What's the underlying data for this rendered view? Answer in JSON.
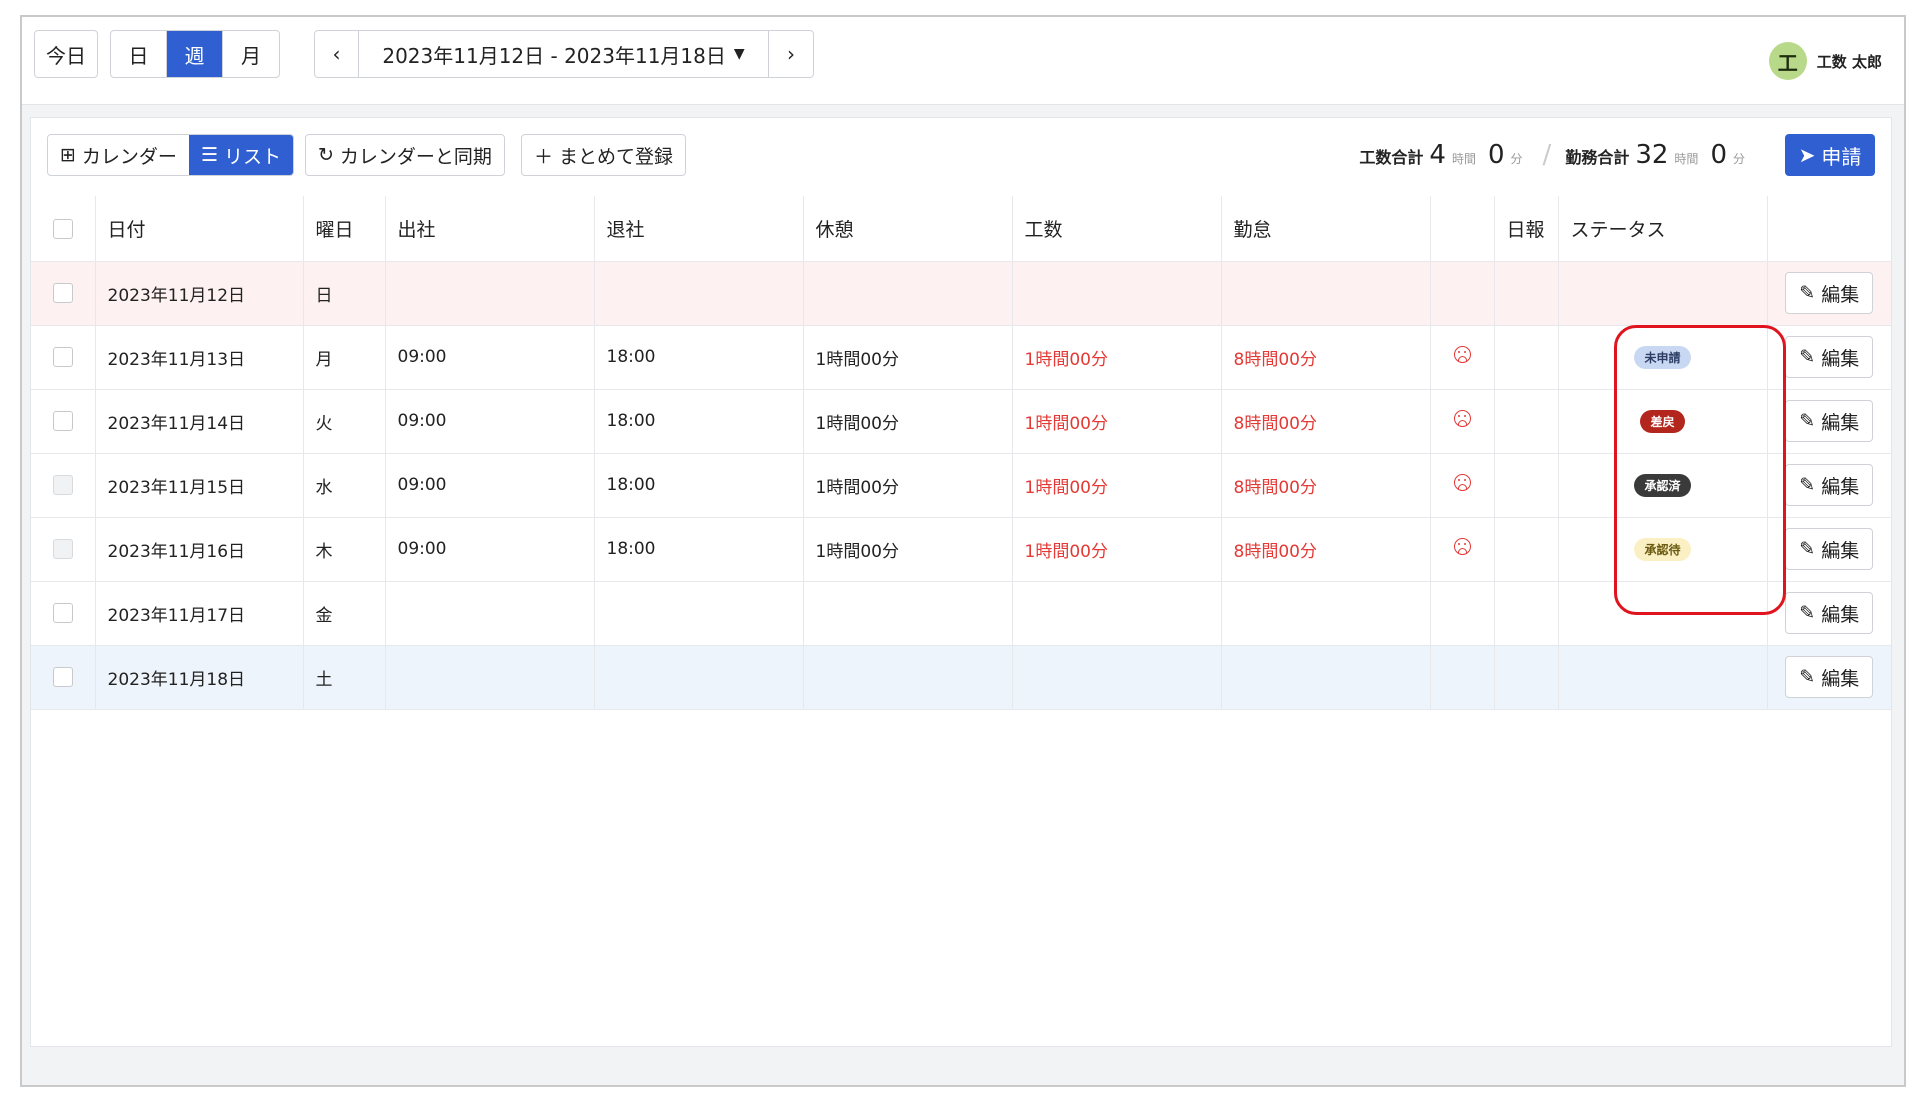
{
  "topbar": {
    "today_label": "今日",
    "view_tabs": [
      {
        "label": "日",
        "active": false
      },
      {
        "label": "週",
        "active": true
      },
      {
        "label": "月",
        "active": false
      }
    ],
    "date_range": "2023年11月12日 - 2023年11月18日",
    "prev_icon": "chevron-left-icon",
    "next_icon": "chevron-right-icon"
  },
  "user": {
    "avatar_text": "工",
    "name": "工数 太郎"
  },
  "toolbar": {
    "calendar_view_label": "カレンダー",
    "list_view_label": "リスト",
    "sync_label": "カレンダーと同期",
    "bulk_register_label": "まとめて登録",
    "apply_label": "申請"
  },
  "summary": {
    "kousu_label": "工数合計",
    "kousu_hours": "4",
    "kousu_minutes": "0",
    "kintai_label": "勤務合計",
    "kintai_hours": "32",
    "kintai_minutes": "0",
    "hour_unit": "時間",
    "minute_unit": "分"
  },
  "table": {
    "headers": [
      "日付",
      "曜日",
      "出社",
      "退社",
      "休憩",
      "工数",
      "勤怠",
      "",
      "日報",
      "ステータス",
      ""
    ],
    "edit_label": "編集",
    "rows": [
      {
        "date": "2023年11月12日",
        "weekday": "日",
        "in": "",
        "out": "",
        "break": "",
        "kousu": "",
        "kintai": "",
        "frown": false,
        "status": "",
        "status_style": ""
      },
      {
        "date": "2023年11月13日",
        "weekday": "月",
        "in": "09:00",
        "out": "18:00",
        "break": "1時間00分",
        "kousu": "1時間00分",
        "kintai": "8時間00分",
        "frown": true,
        "status": "未申請",
        "status_style": "blue"
      },
      {
        "date": "2023年11月14日",
        "weekday": "火",
        "in": "09:00",
        "out": "18:00",
        "break": "1時間00分",
        "kousu": "1時間00分",
        "kintai": "8時間00分",
        "frown": true,
        "status": "差戻",
        "status_style": "red"
      },
      {
        "date": "2023年11月15日",
        "weekday": "水",
        "in": "09:00",
        "out": "18:00",
        "break": "1時間00分",
        "kousu": "1時間00分",
        "kintai": "8時間00分",
        "frown": true,
        "status": "承認済",
        "status_style": "dark"
      },
      {
        "date": "2023年11月16日",
        "weekday": "木",
        "in": "09:00",
        "out": "18:00",
        "break": "1時間00分",
        "kousu": "1時間00分",
        "kintai": "8時間00分",
        "frown": true,
        "status": "承認待",
        "status_style": "yellow"
      },
      {
        "date": "2023年11月17日",
        "weekday": "金",
        "in": "",
        "out": "",
        "break": "",
        "kousu": "",
        "kintai": "",
        "frown": false,
        "status": "",
        "status_style": ""
      },
      {
        "date": "2023年11月18日",
        "weekday": "土",
        "in": "",
        "out": "",
        "break": "",
        "kousu": "",
        "kintai": "",
        "frown": false,
        "status": "",
        "status_style": ""
      }
    ]
  },
  "colors": {
    "accent": "#2f5fd1",
    "overtime_red": "#e53935",
    "highlight_red": "#e0141e",
    "badge_blue_bg": "#c9d8f2",
    "badge_red_bg": "#b3261e",
    "badge_dark_bg": "#3a3a3a",
    "badge_yellow_bg": "#fbf0c4"
  }
}
